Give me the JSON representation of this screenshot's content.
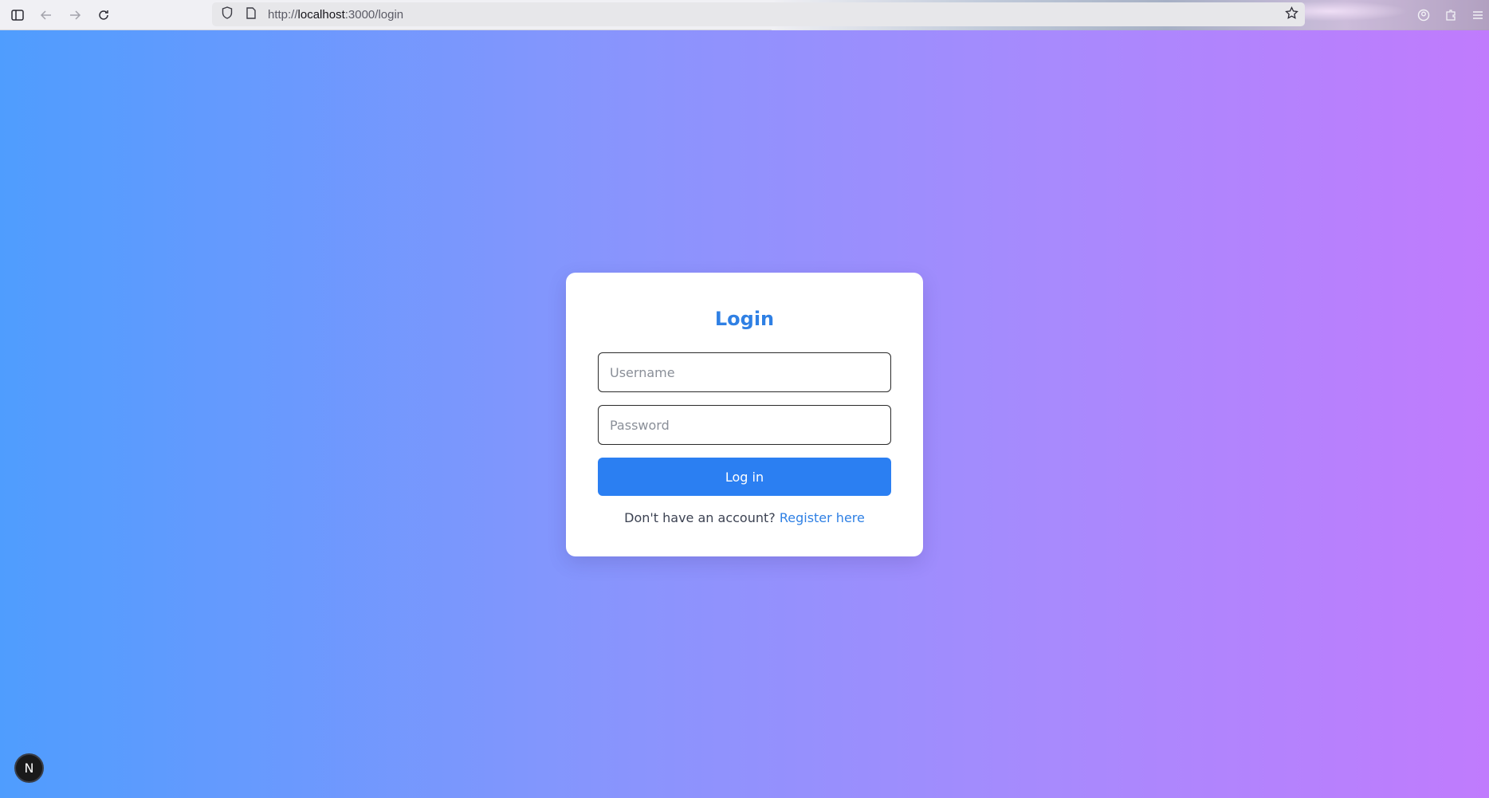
{
  "browser": {
    "url_scheme": "http://",
    "url_host": "localhost",
    "url_rest": ":3000/login"
  },
  "icons": {
    "sidebar": "sidebar-icon",
    "back": "arrow-left-icon",
    "forward": "arrow-right-icon",
    "reload": "reload-icon",
    "shield": "shield-icon",
    "page": "page-icon",
    "bookmark": "star-icon"
  },
  "login": {
    "title": "Login",
    "username_placeholder": "Username",
    "password_placeholder": "Password",
    "submit_label": "Log in",
    "register_prompt": "Don't have an account?",
    "register_link": "Register here"
  },
  "dev_badge": {
    "label": "N"
  },
  "colors": {
    "accent": "#2b7ff2",
    "title": "#2f80e4",
    "gradient_start": "#4f9dfe",
    "gradient_end": "#c07bfd"
  }
}
